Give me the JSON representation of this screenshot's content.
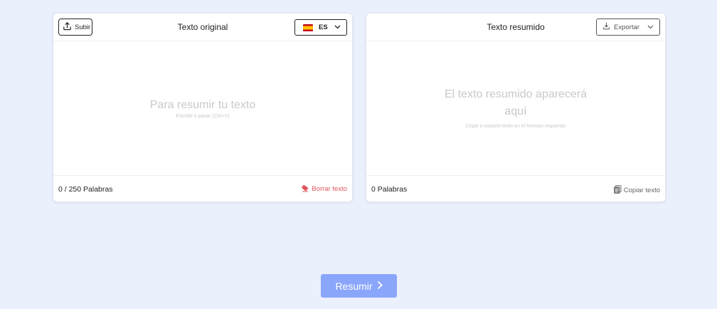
{
  "colors": {
    "background": "#ebf0fd",
    "primary_button": "#8aa6fb",
    "clear_red": "#e0565b",
    "placeholder_gray": "#c7c9cd"
  },
  "left_panel": {
    "upload_label": "Subir",
    "upload_icon": "upload-icon",
    "title": "Texto original",
    "language_code": "ES",
    "language_flag": "spain-flag-icon",
    "placeholder_main": "Para resumir tu texto",
    "placeholder_sub": "Escribir o pasar (Ctrl+V)",
    "word_count": "0 / 250 Palabras",
    "clear_label": "Borrar texto",
    "clear_icon": "eraser-icon"
  },
  "right_panel": {
    "title": "Texto resumido",
    "export_label": "Exportar",
    "export_icon": "download-icon",
    "placeholder_main_line1": "El texto resumido aparecerá",
    "placeholder_main_line2": "aquí",
    "placeholder_sub": "Copie o exporte texto en el formato requerido",
    "word_count": "0 Palabras",
    "copy_label": "Copiar texto",
    "copy_icon": "copy-icon"
  },
  "actions": {
    "summarize_label": "Resumir",
    "summarize_icon": "chevron-right-icon"
  }
}
